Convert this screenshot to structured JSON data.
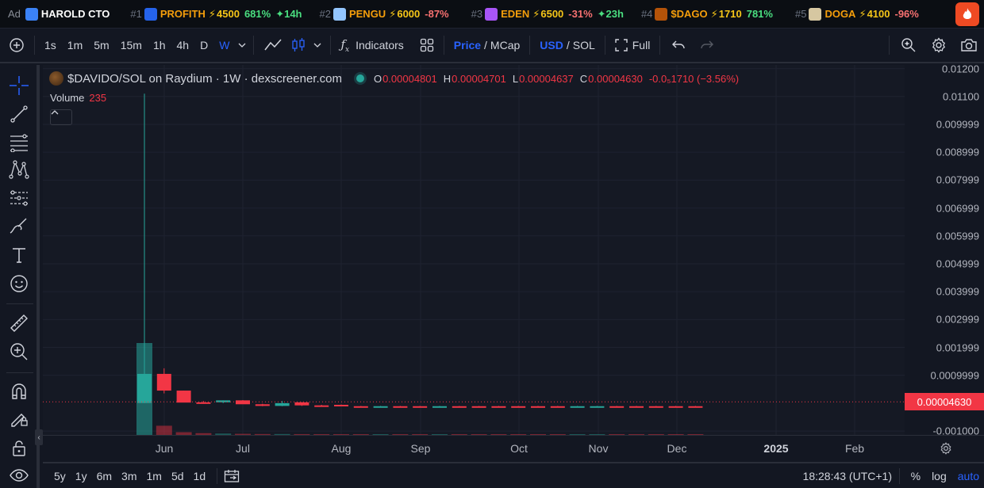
{
  "ticker": {
    "ad_label": "Ad",
    "items": [
      {
        "rank": "",
        "name": "HAROLD CTO",
        "boost": "",
        "change": "",
        "change_dir": "",
        "age": "",
        "avatar_color": "#3b82f6",
        "name_style": "white"
      },
      {
        "rank": "#1",
        "name": "PROFITH",
        "boost": "4500",
        "change": "681%",
        "change_dir": "pos",
        "age": "14h",
        "avatar_color": "#2563eb",
        "name_style": "orange"
      },
      {
        "rank": "#2",
        "name": "PENGU",
        "boost": "6000",
        "change": "-87%",
        "change_dir": "neg",
        "age": "",
        "avatar_color": "#93c5fd",
        "name_style": "orange"
      },
      {
        "rank": "#3",
        "name": "EDEN",
        "boost": "6500",
        "change": "-31%",
        "change_dir": "neg",
        "age": "23h",
        "avatar_color": "#a855f7",
        "name_style": "orange"
      },
      {
        "rank": "#4",
        "name": "$DAGO",
        "boost": "1710",
        "change": "781%",
        "change_dir": "pos",
        "age": "",
        "avatar_color": "#b45309",
        "name_style": "orange"
      },
      {
        "rank": "#5",
        "name": "DOGA",
        "boost": "4100",
        "change": "-96%",
        "change_dir": "neg",
        "age": "",
        "avatar_color": "#d6c7a1",
        "name_style": "orange"
      }
    ],
    "fire_icon": "fire-icon"
  },
  "toolbar": {
    "intervals": [
      "1s",
      "1m",
      "5m",
      "15m",
      "1h",
      "4h",
      "D",
      "W"
    ],
    "active_interval": "W",
    "indicators_label": "Indicators",
    "price_label": "Price",
    "mcap_label": "MCap",
    "usd_label": "USD",
    "sol_label": "SOL",
    "full_label": "Full"
  },
  "legend": {
    "symbol": "$DAVIDO/SOL on Raydium · 1W · dexscreener.com",
    "o_key": "O",
    "o_val": "0.00004801",
    "h_key": "H",
    "h_val": "0.00004701",
    "l_key": "L",
    "l_val": "0.00004637",
    "c_key": "C",
    "c_val": "0.00004630",
    "change": "-0.0₅1710 (−3.56%)",
    "volume_label": "Volume",
    "volume_value": "235"
  },
  "price_axis": {
    "labels": [
      "0.01200",
      "0.01100",
      "0.009999",
      "0.008999",
      "0.007999",
      "0.006999",
      "0.005999",
      "0.004999",
      "0.003999",
      "0.002999",
      "0.001999",
      "0.0009999",
      "-0.001000"
    ],
    "current_price": "0.00004630"
  },
  "time_axis": {
    "labels": [
      "Jun",
      "Jul",
      "Aug",
      "Sep",
      "Oct",
      "Nov",
      "Dec",
      "2025",
      "Feb"
    ]
  },
  "bottom": {
    "ranges": [
      "5y",
      "1y",
      "6m",
      "3m",
      "1m",
      "5d",
      "1d"
    ],
    "clock": "18:28:43 (UTC+1)",
    "percent_label": "%",
    "log_label": "log",
    "auto_label": "auto"
  },
  "colors": {
    "up": "#26a69a",
    "down": "#f23645",
    "accent": "#2962ff",
    "background": "#131722"
  },
  "chart_data": {
    "type": "candlestick",
    "interval": "1W",
    "candles": [
      {
        "open": 5e-06,
        "high": 0.0111,
        "low": 5e-06,
        "close": 0.00105,
        "dir": "up",
        "volume": 1
      },
      {
        "open": 0.00105,
        "high": 0.00125,
        "low": 0.00035,
        "close": 0.00045,
        "dir": "down",
        "volume": 0.1
      },
      {
        "open": 0.00045,
        "high": 0.00045,
        "low": 0.0002,
        "close": 2e-05,
        "dir": "down",
        "volume": 0.03
      },
      {
        "open": 2e-05,
        "high": 8e-05,
        "low": -2e-05,
        "close": 3e-05,
        "dir": "down",
        "volume": 0.02
      },
      {
        "open": 3e-05,
        "high": 0.0001,
        "low": 0.0,
        "close": 0.0001,
        "dir": "up",
        "volume": 0.015
      },
      {
        "open": 0.0001,
        "high": 0.00011,
        "low": -3e-05,
        "close": -4e-05,
        "dir": "down",
        "volume": 0.012
      },
      {
        "open": -4e-05,
        "high": -2e-05,
        "low": -0.00011,
        "close": -0.0001,
        "dir": "down",
        "volume": 0.01
      },
      {
        "open": -0.0001,
        "high": 8e-05,
        "low": -0.00011,
        "close": 0.0,
        "dir": "up",
        "volume": 0.01
      },
      {
        "open": 3e-05,
        "high": 4e-05,
        "low": -0.0001,
        "close": -8e-05,
        "dir": "down",
        "volume": 0.009
      },
      {
        "open": -8e-05,
        "high": -6e-05,
        "low": -0.00011,
        "close": -0.0001,
        "dir": "down",
        "volume": 0.008
      },
      {
        "open": -6e-05,
        "high": -5e-05,
        "low": -0.00011,
        "close": -0.00011,
        "dir": "down",
        "volume": 0.008
      },
      {
        "open": -0.00011,
        "high": -0.0001,
        "low": -0.00012,
        "close": -0.00011,
        "dir": "down",
        "volume": 0.007
      },
      {
        "open": -0.00011,
        "high": -0.0001,
        "low": -0.00012,
        "close": -0.00011,
        "dir": "up",
        "volume": 0.007
      },
      {
        "open": -0.00011,
        "high": -0.0001,
        "low": -0.00012,
        "close": -0.00011,
        "dir": "down",
        "volume": 0.007
      },
      {
        "open": -0.00011,
        "high": -0.0001,
        "low": -0.00012,
        "close": -0.00011,
        "dir": "down",
        "volume": 0.006
      },
      {
        "open": -0.00011,
        "high": -0.0001,
        "low": -0.00012,
        "close": -0.00011,
        "dir": "up",
        "volume": 0.006
      },
      {
        "open": -0.00011,
        "high": -0.0001,
        "low": -0.00012,
        "close": -0.00011,
        "dir": "down",
        "volume": 0.006
      },
      {
        "open": -0.00011,
        "high": -0.0001,
        "low": -0.00012,
        "close": -0.00011,
        "dir": "down",
        "volume": 0.006
      },
      {
        "open": -0.00011,
        "high": -0.0001,
        "low": -0.00012,
        "close": -0.00011,
        "dir": "down",
        "volume": 0.006
      },
      {
        "open": -0.00011,
        "high": -0.0001,
        "low": -0.00012,
        "close": -0.00011,
        "dir": "down",
        "volume": 0.005
      },
      {
        "open": -0.00011,
        "high": -0.0001,
        "low": -0.00012,
        "close": -0.00011,
        "dir": "down",
        "volume": 0.005
      },
      {
        "open": -0.00011,
        "high": -0.0001,
        "low": -0.00013,
        "close": -0.00012,
        "dir": "down",
        "volume": 0.005
      },
      {
        "open": -0.00012,
        "high": -0.0001,
        "low": -0.00013,
        "close": -0.00011,
        "dir": "up",
        "volume": 0.005
      },
      {
        "open": -0.00011,
        "high": -0.0001,
        "low": -0.00012,
        "close": -0.00011,
        "dir": "up",
        "volume": 0.004
      },
      {
        "open": -0.00011,
        "high": -0.0001,
        "low": -0.00012,
        "close": -0.00011,
        "dir": "down",
        "volume": 0.004
      },
      {
        "open": -0.00011,
        "high": -0.0001,
        "low": -0.00012,
        "close": -0.00011,
        "dir": "down",
        "volume": 0.004
      },
      {
        "open": -0.00011,
        "high": -0.0001,
        "low": -0.00012,
        "close": -0.00011,
        "dir": "down",
        "volume": 0.004
      },
      {
        "open": -0.00011,
        "high": -0.0001,
        "low": -0.00012,
        "close": -0.00011,
        "dir": "down",
        "volume": 0.004
      },
      {
        "open": -0.00011,
        "high": -0.0001,
        "low": -0.00012,
        "close": -0.00011,
        "dir": "down",
        "volume": 0.003
      }
    ],
    "ylim": [
      -0.00114,
      0.01213
    ],
    "grid": true,
    "current_price_line": 4.63e-05
  }
}
